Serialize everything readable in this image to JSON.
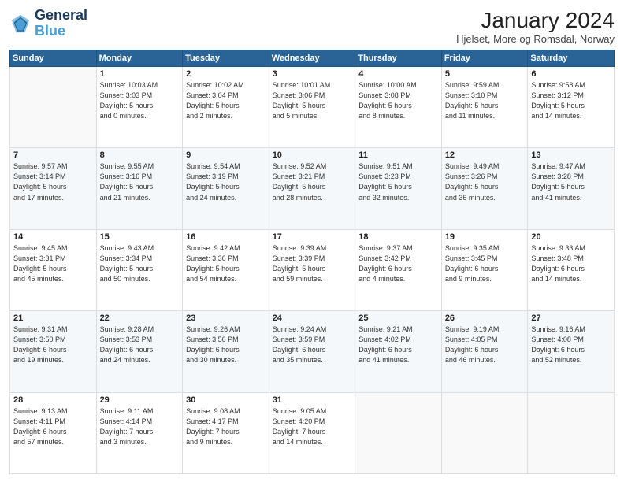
{
  "logo": {
    "line1": "General",
    "line2": "Blue"
  },
  "title": "January 2024",
  "subtitle": "Hjelset, More og Romsdal, Norway",
  "days_of_week": [
    "Sunday",
    "Monday",
    "Tuesday",
    "Wednesday",
    "Thursday",
    "Friday",
    "Saturday"
  ],
  "weeks": [
    [
      {
        "num": "",
        "info": ""
      },
      {
        "num": "1",
        "info": "Sunrise: 10:03 AM\nSunset: 3:03 PM\nDaylight: 5 hours\nand 0 minutes."
      },
      {
        "num": "2",
        "info": "Sunrise: 10:02 AM\nSunset: 3:04 PM\nDaylight: 5 hours\nand 2 minutes."
      },
      {
        "num": "3",
        "info": "Sunrise: 10:01 AM\nSunset: 3:06 PM\nDaylight: 5 hours\nand 5 minutes."
      },
      {
        "num": "4",
        "info": "Sunrise: 10:00 AM\nSunset: 3:08 PM\nDaylight: 5 hours\nand 8 minutes."
      },
      {
        "num": "5",
        "info": "Sunrise: 9:59 AM\nSunset: 3:10 PM\nDaylight: 5 hours\nand 11 minutes."
      },
      {
        "num": "6",
        "info": "Sunrise: 9:58 AM\nSunset: 3:12 PM\nDaylight: 5 hours\nand 14 minutes."
      }
    ],
    [
      {
        "num": "7",
        "info": "Sunrise: 9:57 AM\nSunset: 3:14 PM\nDaylight: 5 hours\nand 17 minutes."
      },
      {
        "num": "8",
        "info": "Sunrise: 9:55 AM\nSunset: 3:16 PM\nDaylight: 5 hours\nand 21 minutes."
      },
      {
        "num": "9",
        "info": "Sunrise: 9:54 AM\nSunset: 3:19 PM\nDaylight: 5 hours\nand 24 minutes."
      },
      {
        "num": "10",
        "info": "Sunrise: 9:52 AM\nSunset: 3:21 PM\nDaylight: 5 hours\nand 28 minutes."
      },
      {
        "num": "11",
        "info": "Sunrise: 9:51 AM\nSunset: 3:23 PM\nDaylight: 5 hours\nand 32 minutes."
      },
      {
        "num": "12",
        "info": "Sunrise: 9:49 AM\nSunset: 3:26 PM\nDaylight: 5 hours\nand 36 minutes."
      },
      {
        "num": "13",
        "info": "Sunrise: 9:47 AM\nSunset: 3:28 PM\nDaylight: 5 hours\nand 41 minutes."
      }
    ],
    [
      {
        "num": "14",
        "info": "Sunrise: 9:45 AM\nSunset: 3:31 PM\nDaylight: 5 hours\nand 45 minutes."
      },
      {
        "num": "15",
        "info": "Sunrise: 9:43 AM\nSunset: 3:34 PM\nDaylight: 5 hours\nand 50 minutes."
      },
      {
        "num": "16",
        "info": "Sunrise: 9:42 AM\nSunset: 3:36 PM\nDaylight: 5 hours\nand 54 minutes."
      },
      {
        "num": "17",
        "info": "Sunrise: 9:39 AM\nSunset: 3:39 PM\nDaylight: 5 hours\nand 59 minutes."
      },
      {
        "num": "18",
        "info": "Sunrise: 9:37 AM\nSunset: 3:42 PM\nDaylight: 6 hours\nand 4 minutes."
      },
      {
        "num": "19",
        "info": "Sunrise: 9:35 AM\nSunset: 3:45 PM\nDaylight: 6 hours\nand 9 minutes."
      },
      {
        "num": "20",
        "info": "Sunrise: 9:33 AM\nSunset: 3:48 PM\nDaylight: 6 hours\nand 14 minutes."
      }
    ],
    [
      {
        "num": "21",
        "info": "Sunrise: 9:31 AM\nSunset: 3:50 PM\nDaylight: 6 hours\nand 19 minutes."
      },
      {
        "num": "22",
        "info": "Sunrise: 9:28 AM\nSunset: 3:53 PM\nDaylight: 6 hours\nand 24 minutes."
      },
      {
        "num": "23",
        "info": "Sunrise: 9:26 AM\nSunset: 3:56 PM\nDaylight: 6 hours\nand 30 minutes."
      },
      {
        "num": "24",
        "info": "Sunrise: 9:24 AM\nSunset: 3:59 PM\nDaylight: 6 hours\nand 35 minutes."
      },
      {
        "num": "25",
        "info": "Sunrise: 9:21 AM\nSunset: 4:02 PM\nDaylight: 6 hours\nand 41 minutes."
      },
      {
        "num": "26",
        "info": "Sunrise: 9:19 AM\nSunset: 4:05 PM\nDaylight: 6 hours\nand 46 minutes."
      },
      {
        "num": "27",
        "info": "Sunrise: 9:16 AM\nSunset: 4:08 PM\nDaylight: 6 hours\nand 52 minutes."
      }
    ],
    [
      {
        "num": "28",
        "info": "Sunrise: 9:13 AM\nSunset: 4:11 PM\nDaylight: 6 hours\nand 57 minutes."
      },
      {
        "num": "29",
        "info": "Sunrise: 9:11 AM\nSunset: 4:14 PM\nDaylight: 7 hours\nand 3 minutes."
      },
      {
        "num": "30",
        "info": "Sunrise: 9:08 AM\nSunset: 4:17 PM\nDaylight: 7 hours\nand 9 minutes."
      },
      {
        "num": "31",
        "info": "Sunrise: 9:05 AM\nSunset: 4:20 PM\nDaylight: 7 hours\nand 14 minutes."
      },
      {
        "num": "",
        "info": ""
      },
      {
        "num": "",
        "info": ""
      },
      {
        "num": "",
        "info": ""
      }
    ]
  ]
}
